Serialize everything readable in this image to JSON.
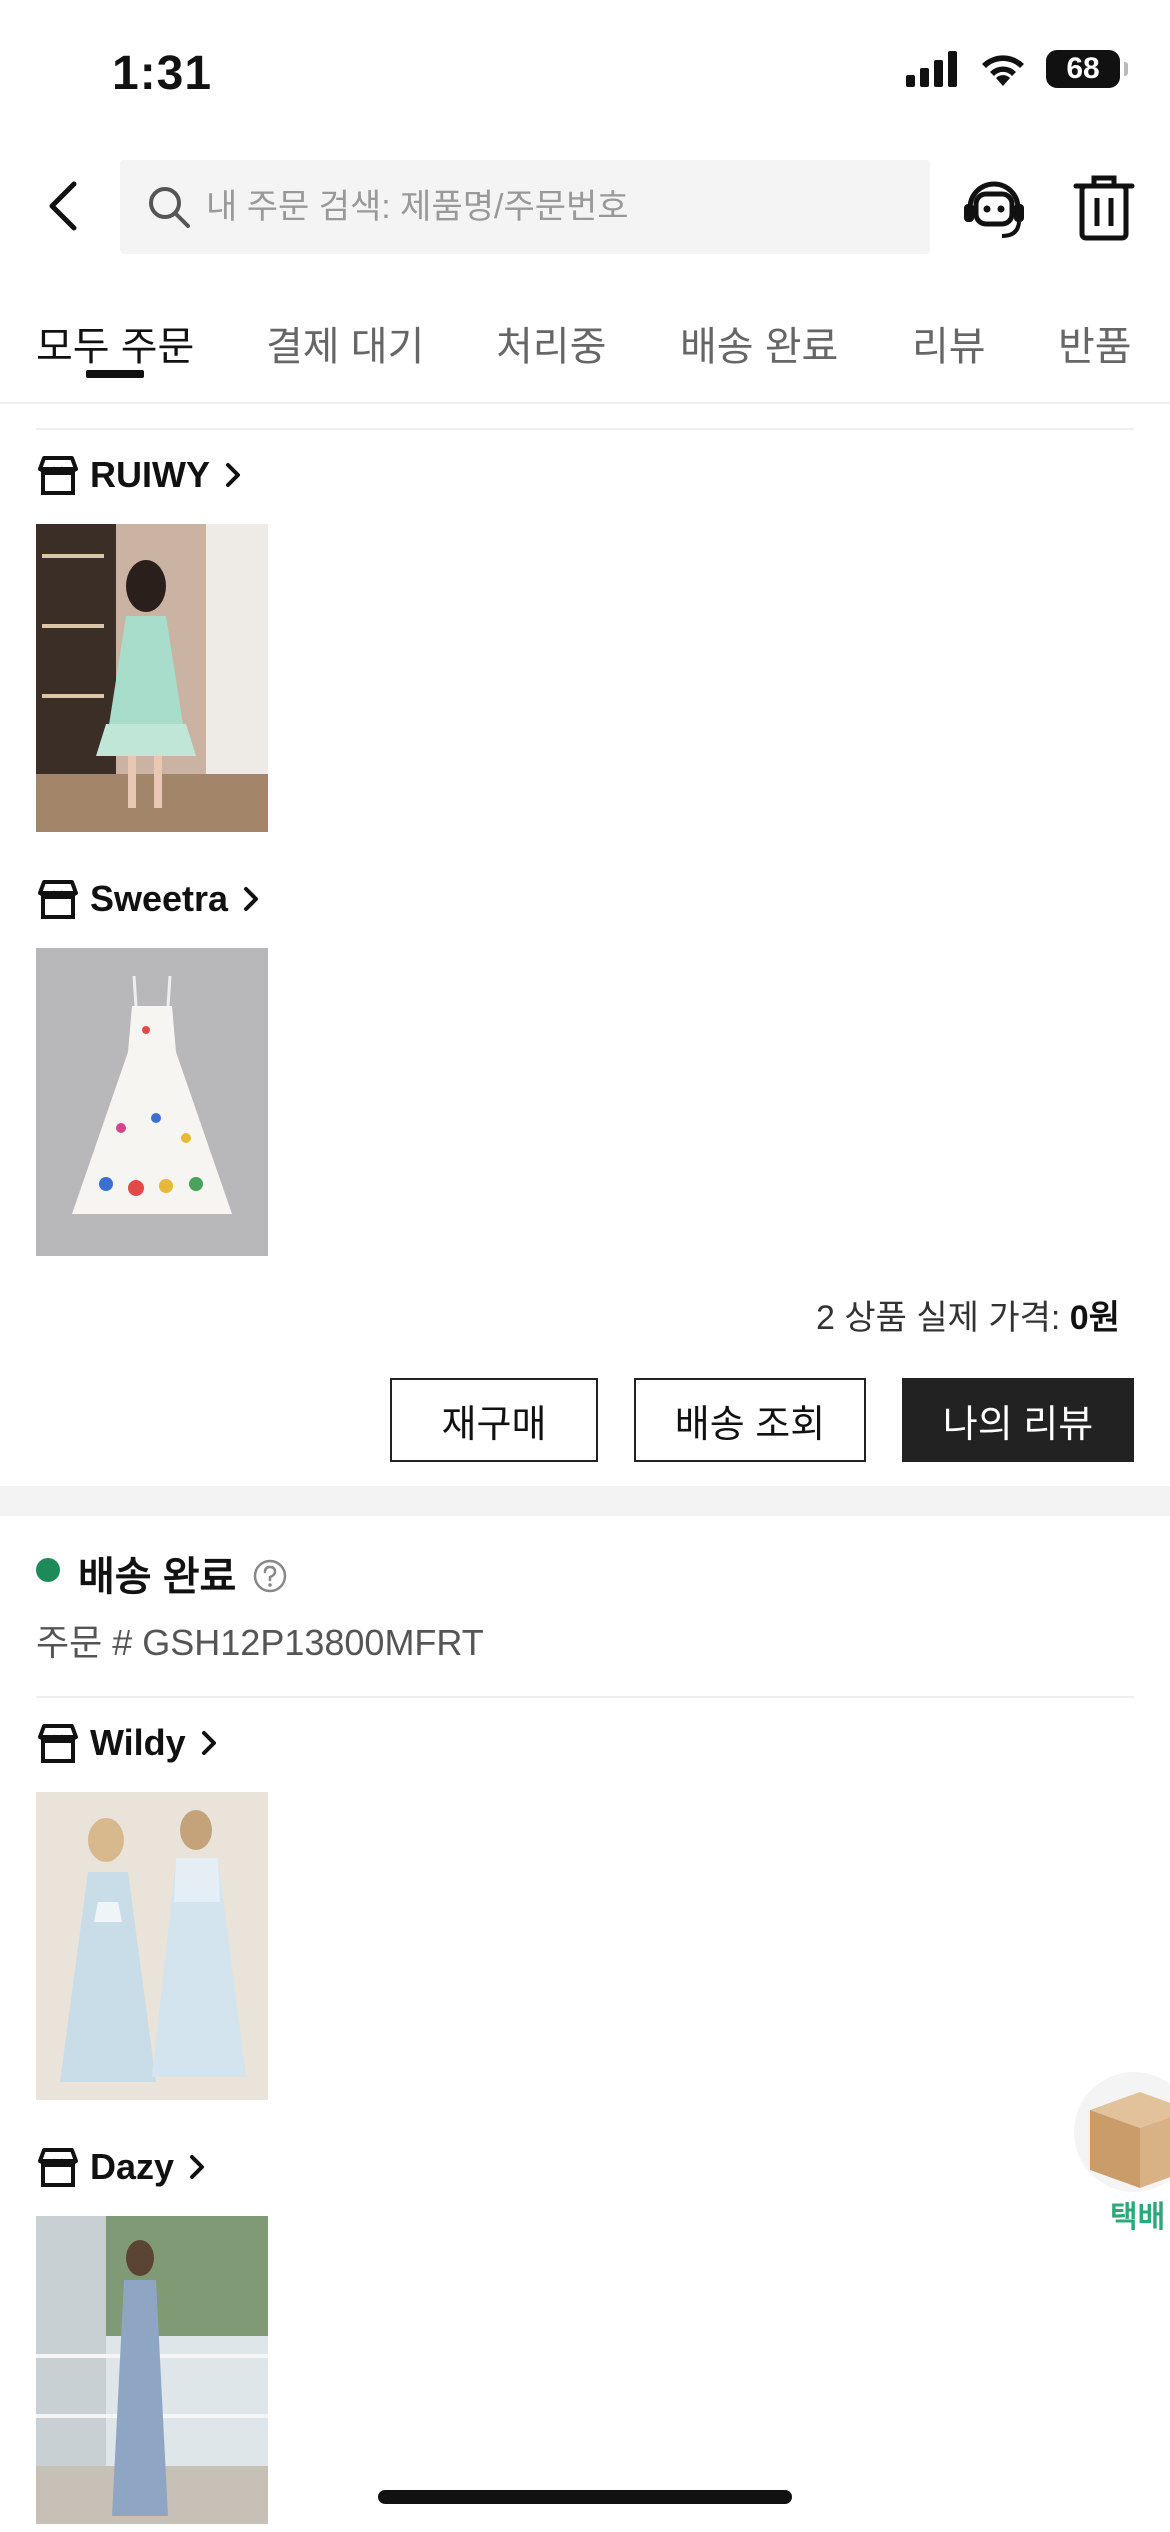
{
  "status": {
    "time": "1:31",
    "battery": "68"
  },
  "search": {
    "placeholder": "내 주문 검색: 제품명/주문번호"
  },
  "tabs": [
    "모두 주문",
    "결제 대기",
    "처리중",
    "배송 완료",
    "리뷰",
    "반품"
  ],
  "order1": {
    "stores": [
      "RUIWY",
      "Sweetra"
    ],
    "price": {
      "label": "2 상품 실제 가격:",
      "value": "0원"
    },
    "buttons": {
      "rebuy": "재구매",
      "track": "배송 조회",
      "review": "나의 리뷰"
    }
  },
  "order2": {
    "status": "배송 완료",
    "order_number": "주문 #  GSH12P13800MFRT",
    "stores": [
      "Wildy",
      "Dazy"
    ]
  },
  "floating": {
    "label": "택배"
  },
  "colors": {
    "accent_green": "#1e8a5a",
    "dark_button": "#222222"
  }
}
